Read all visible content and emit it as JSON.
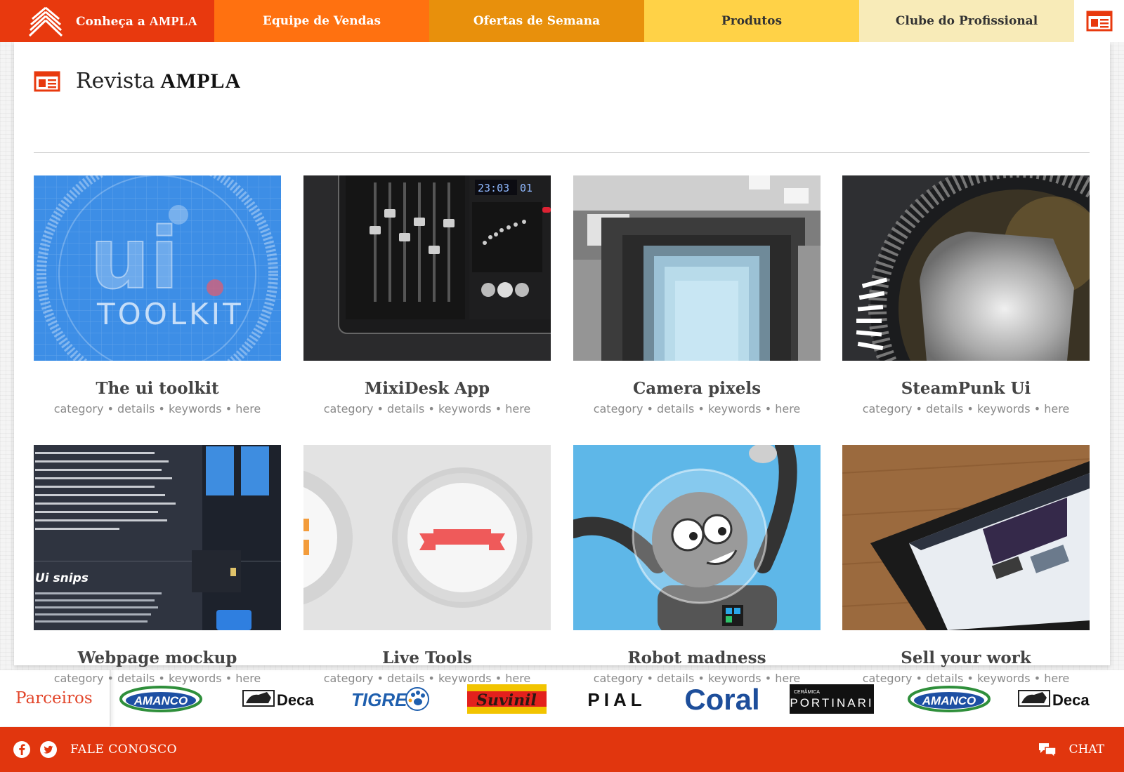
{
  "nav": {
    "brand_prefix": "Conheça a",
    "brand_word": "AMPLA",
    "tabs": [
      {
        "label": "Equipe de Vendas",
        "color": "#ff7110"
      },
      {
        "label": "Ofertas de Semana",
        "color": "#e8900c"
      },
      {
        "label": "Produtos",
        "color": "#ffd247"
      },
      {
        "label": "Clube do Profissional",
        "color": "#f8ebb8"
      }
    ],
    "brand_color": "#e8390e",
    "magazine_icon": "newspaper-icon"
  },
  "page": {
    "title_prefix": "Revista",
    "title_brand": "AMPLA",
    "title_icon": "newspaper-icon"
  },
  "cards": [
    {
      "title": "The ui toolkit",
      "meta": "category • details • keywords • here"
    },
    {
      "title": "MixiDesk App",
      "meta": "category • details • keywords • here"
    },
    {
      "title": "Camera pixels",
      "meta": "category • details • keywords • here"
    },
    {
      "title": "SteamPunk Ui",
      "meta": "category • details • keywords • here"
    },
    {
      "title": "Webpage mockup",
      "meta": "category • details • keywords • here"
    },
    {
      "title": "Live Tools",
      "meta": "category • details • keywords • here"
    },
    {
      "title": "Robot madness",
      "meta": "category • details • keywords • here"
    },
    {
      "title": "Sell your work",
      "meta": "category • details • keywords • here"
    }
  ],
  "thumb_text": {
    "toolkit_big": "ui",
    "toolkit_word": "TOOLKIT",
    "mixidesk_clock": "23:03",
    "mixidesk_count": "01",
    "mockup_heading": "Ui snips"
  },
  "partners": {
    "label": "Parceiros",
    "logos": [
      "AMANCO",
      "Deca",
      "TIGRE",
      "Suvinil",
      "PIAL",
      "Coral",
      "PORTINARI",
      "AMANCO",
      "Deca"
    ],
    "portinari_small": "CERÂMICA"
  },
  "footer": {
    "contact_label": "FALE CONOSCO",
    "chat_label": "CHAT",
    "icons": [
      "facebook-icon",
      "twitter-icon",
      "chat-bubbles-icon"
    ]
  }
}
